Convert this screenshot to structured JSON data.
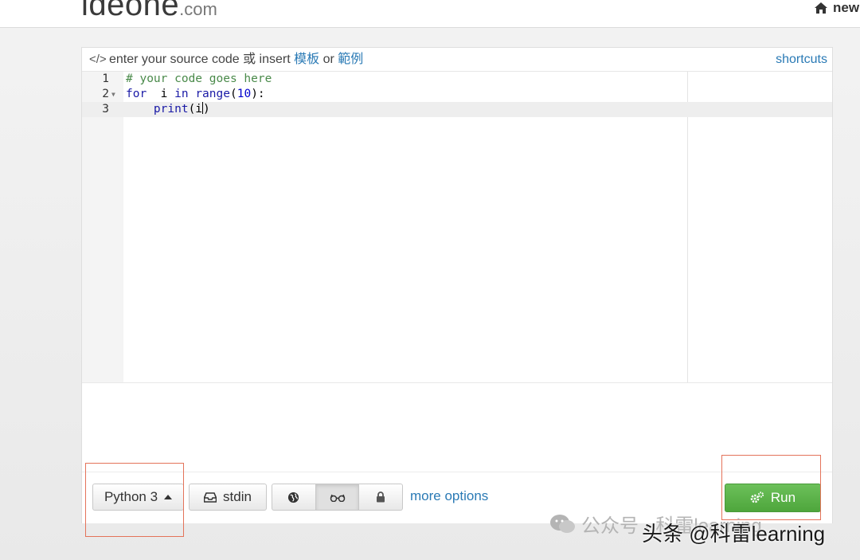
{
  "site": {
    "logo_main": "ideone",
    "logo_suffix": ".com",
    "new_label": "new"
  },
  "editor_header": {
    "prefix": "enter your source code 或 insert ",
    "link_template": "模板",
    "or_text": " or ",
    "link_example": "範例",
    "shortcuts_label": "shortcuts"
  },
  "code": {
    "lines": [
      {
        "number": "1",
        "comment": "# your code goes here"
      },
      {
        "number": "2",
        "kw1": "for",
        "mid1": "  i ",
        "kw2": "in",
        "sp": " ",
        "fn": "range",
        "open": "(",
        "num": "10",
        "close": "):"
      },
      {
        "number": "3",
        "indent": "    ",
        "fn": "print",
        "args": "(i",
        "close": ")"
      }
    ]
  },
  "toolbar": {
    "language_label": "Python 3",
    "stdin_label": "stdin",
    "more_options_label": "more options",
    "run_label": "Run"
  },
  "icons": {
    "home": "home-icon",
    "code": "code-icon",
    "stdin": "inbox-icon",
    "public": "globe-icon",
    "hidden": "glasses-icon",
    "private": "lock-icon",
    "run": "gears-icon"
  },
  "watermark": {
    "text1": "公众号 · 科雷learning",
    "text2": "头条 @科雷learning"
  },
  "colors": {
    "link": "#2a7ab5",
    "run_button": "#5cb349",
    "highlight_box": "#e4735a"
  }
}
